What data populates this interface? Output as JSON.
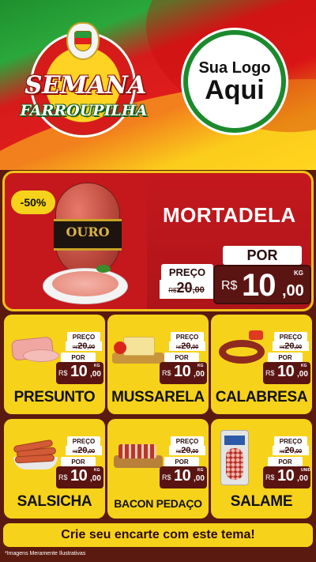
{
  "header": {
    "event_line1": "SEMANA",
    "event_line2": "FARROUPILHA",
    "logo_line1": "Sua Logo",
    "logo_line2": "Aqui"
  },
  "featured": {
    "discount": "-50%",
    "brand": "OURO",
    "name": "MORTADELA",
    "preco_label": "PREÇO",
    "old_currency": "R$",
    "old_int": "20",
    "old_dec": ",00",
    "por_label": "POR",
    "currency": "R$",
    "price_int": "10",
    "price_dec": ",00",
    "unit": "KG"
  },
  "products": [
    {
      "name": "PRESUNTO",
      "preco_label": "PREÇO",
      "old_currency": "R$",
      "old_int": "20",
      "old_dec": ",00",
      "por_label": "POR",
      "currency": "R$",
      "price_int": "10",
      "price_dec": ",00",
      "unit": "KG"
    },
    {
      "name": "MUSSARELA",
      "preco_label": "PREÇO",
      "old_currency": "R$",
      "old_int": "20",
      "old_dec": ",00",
      "por_label": "POR",
      "currency": "R$",
      "price_int": "10",
      "price_dec": ",00",
      "unit": "KG"
    },
    {
      "name": "CALABRESA",
      "preco_label": "PREÇO",
      "old_currency": "R$",
      "old_int": "20",
      "old_dec": ",00",
      "por_label": "POR",
      "currency": "R$",
      "price_int": "10",
      "price_dec": ",00",
      "unit": "KG"
    },
    {
      "name": "SALSICHA",
      "preco_label": "PREÇO",
      "old_currency": "R$",
      "old_int": "20",
      "old_dec": ",00",
      "por_label": "POR",
      "currency": "R$",
      "price_int": "10",
      "price_dec": ",00",
      "unit": "KG"
    },
    {
      "name": "BACON PEDAÇO",
      "preco_label": "PREÇO",
      "old_currency": "R$",
      "old_int": "20",
      "old_dec": ",00",
      "por_label": "POR",
      "currency": "R$",
      "price_int": "10",
      "price_dec": ",00",
      "unit": "KG"
    },
    {
      "name": "SALAME",
      "preco_label": "PREÇO",
      "old_currency": "R$",
      "old_int": "20",
      "old_dec": ",00",
      "por_label": "POR",
      "currency": "R$",
      "price_int": "10",
      "price_dec": ",00",
      "unit": "UNID"
    }
  ],
  "footer": {
    "cta": "Crie seu encarte com este tema!",
    "disclaimer": "*Imagens Meramente Ilustrativas"
  },
  "colors": {
    "flag_green": "#1f8f2e",
    "flag_red": "#d61b1b",
    "flag_yellow": "#f7c71a",
    "card_yellow": "#f7d21b",
    "price_box": "#5a1512"
  },
  "icons": [
    "coat-of-arms-icon"
  ]
}
